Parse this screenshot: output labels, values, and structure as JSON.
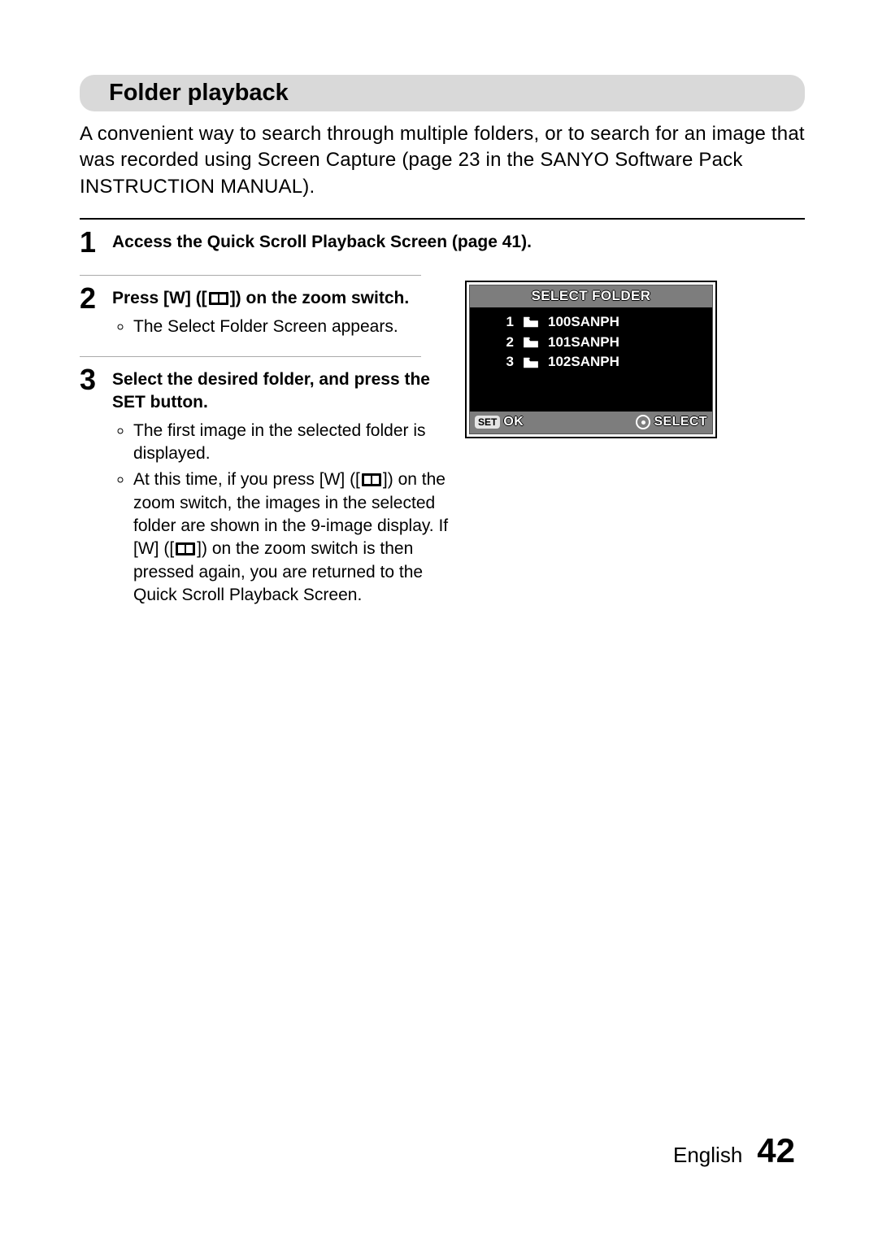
{
  "section_title": "Folder playback",
  "intro": "A convenient way to search through multiple folders, or to search for an image that was recorded using Screen Capture (page 23 in the SANYO Software Pack INSTRUCTION MANUAL).",
  "steps": [
    {
      "num": "1",
      "title_full": "Access the Quick Scroll Playback Screen (page 41).",
      "bullets": []
    },
    {
      "num": "2",
      "title_pre": "Press [W] ([",
      "title_post": "]) on the zoom switch.",
      "bullets": [
        "The Select Folder Screen appears."
      ]
    },
    {
      "num": "3",
      "title_full": "Select the desired folder, and press the SET button.",
      "bullets_b3_0": "The first image in the selected folder is displayed.",
      "bullets_b3_1_pre": "At this time, if you press [W] ([",
      "bullets_b3_1_mid": "]) on the zoom switch, the images in the selected folder are shown in the 9-image display. If [W] ([",
      "bullets_b3_1_post": "]) on the zoom switch is then pressed again, you are returned to the Quick Scroll Playback Screen."
    }
  ],
  "screen": {
    "title": "SELECT FOLDER",
    "folders": [
      {
        "n": "1",
        "name": "100SANPH"
      },
      {
        "n": "2",
        "name": "101SANPH"
      },
      {
        "n": "3",
        "name": "102SANPH"
      }
    ],
    "set_label": "SET",
    "ok_label": "OK",
    "select_label": "SELECT"
  },
  "footer": {
    "lang": "English",
    "page": "42"
  }
}
